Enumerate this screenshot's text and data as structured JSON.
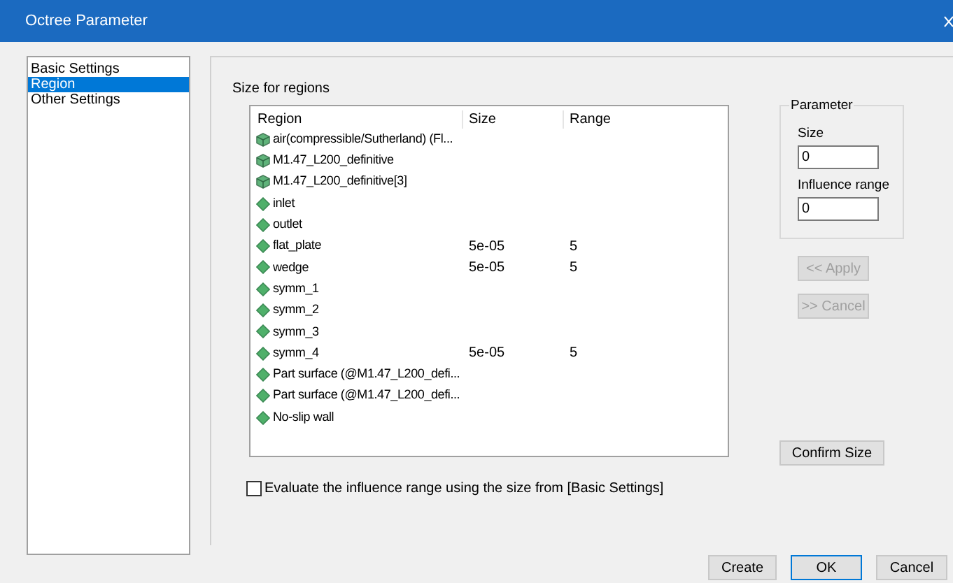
{
  "window": {
    "title": "Octree Parameter"
  },
  "sidebar": {
    "items": [
      {
        "label": "Basic Settings",
        "selected": false
      },
      {
        "label": "Region",
        "selected": true
      },
      {
        "label": "Other Settings",
        "selected": false
      }
    ]
  },
  "section_title": "Size for regions",
  "table": {
    "columns": [
      "Region",
      "Size",
      "Range"
    ],
    "rows": [
      {
        "kind": "volume",
        "region": "air(compressible/Sutherland) (Fl...",
        "size": "",
        "range": ""
      },
      {
        "kind": "volume",
        "region": "M1.47_L200_definitive",
        "size": "",
        "range": ""
      },
      {
        "kind": "volume",
        "region": "M1.47_L200_definitive[3]",
        "size": "",
        "range": ""
      },
      {
        "kind": "surface",
        "region": "inlet",
        "size": "",
        "range": ""
      },
      {
        "kind": "surface",
        "region": "outlet",
        "size": "",
        "range": ""
      },
      {
        "kind": "surface",
        "region": "flat_plate",
        "size": "5e-05",
        "range": "5"
      },
      {
        "kind": "surface",
        "region": "wedge",
        "size": "5e-05",
        "range": "5"
      },
      {
        "kind": "surface",
        "region": "symm_1",
        "size": "",
        "range": ""
      },
      {
        "kind": "surface",
        "region": "symm_2",
        "size": "",
        "range": ""
      },
      {
        "kind": "surface",
        "region": "symm_3",
        "size": "",
        "range": ""
      },
      {
        "kind": "surface",
        "region": "symm_4",
        "size": "5e-05",
        "range": "5"
      },
      {
        "kind": "surface",
        "region": "Part surface (@M1.47_L200_defi...",
        "size": "",
        "range": ""
      },
      {
        "kind": "surface",
        "region": "Part surface (@M1.47_L200_defi...",
        "size": "",
        "range": ""
      },
      {
        "kind": "surface",
        "region": "No-slip wall",
        "size": "",
        "range": ""
      }
    ]
  },
  "parameter": {
    "title": "Parameter",
    "size_label": "Size",
    "size_value": "0",
    "range_label": "Influence range",
    "range_value": "0"
  },
  "apply_button": {
    "label": "<< Apply",
    "disabled": true
  },
  "cancel_edit_button": {
    "label": ">> Cancel",
    "disabled": true
  },
  "confirm_button": "Confirm Size",
  "evaluate_checkbox": {
    "label": "Evaluate the influence range using the size from [Basic Settings]",
    "checked": false
  },
  "footer_buttons": [
    {
      "label": "Create",
      "default": false
    },
    {
      "label": "OK",
      "default": true
    },
    {
      "label": "Cancel",
      "default": false
    }
  ]
}
